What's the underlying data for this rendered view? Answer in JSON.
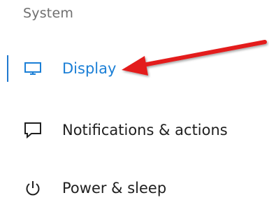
{
  "sidebar": {
    "section_header": "System",
    "items": [
      {
        "label": "Display",
        "icon": "monitor-icon",
        "active": true
      },
      {
        "label": "Notifications & actions",
        "icon": "notification-speech-bubble-icon",
        "active": false
      },
      {
        "label": "Power & sleep",
        "icon": "power-icon",
        "active": false
      }
    ]
  },
  "colors": {
    "accent": "#1b7fd6",
    "text": "#1f1f1f",
    "header_text": "#6f6f6f",
    "arrow": "#e31e1e"
  }
}
